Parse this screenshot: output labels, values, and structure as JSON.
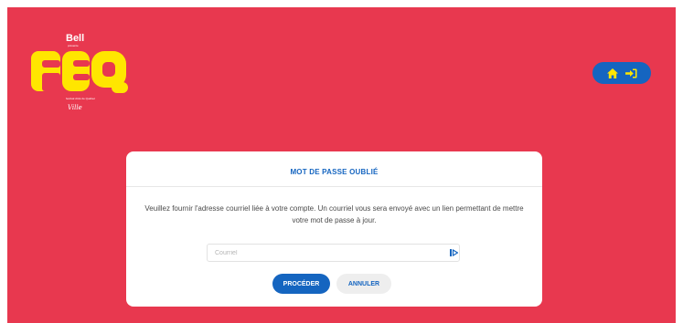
{
  "header": {
    "logo": {
      "sponsor": "Bell",
      "sponsor_sub": "présente",
      "wordmark": "FEQ",
      "tagline": "festival d'été de Québec",
      "brand_script": "Ville"
    },
    "nav": {
      "home_icon": "home-icon",
      "login_icon": "login-icon"
    }
  },
  "dialog": {
    "title": "MOT DE PASSE OUBLIÉ",
    "message": "Veuillez fournir l'adresse courriel liée à votre compte. Un courriel vous sera envoyé avec un lien permettant de mettre votre mot de passe à jour.",
    "email": {
      "value": "",
      "placeholder": "Courriel",
      "icon": "id-card-icon"
    },
    "buttons": {
      "submit": "PROCÉDER",
      "cancel": "ANNULER"
    }
  },
  "colors": {
    "background": "#e8384f",
    "accent": "#1565c0",
    "logo_yellow": "#ffe600",
    "card": "#ffffff"
  }
}
